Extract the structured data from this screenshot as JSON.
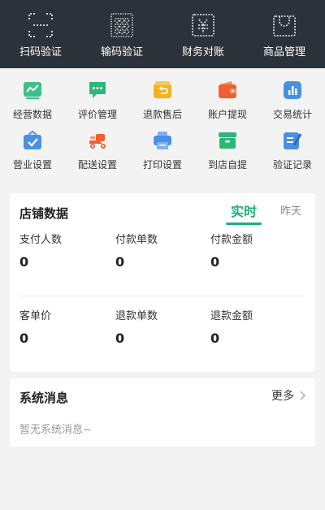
{
  "header": {
    "items": [
      {
        "label": "扫码验证",
        "icon": "scan-icon"
      },
      {
        "label": "输码验证",
        "icon": "code-input-icon"
      },
      {
        "label": "财务对账",
        "icon": "finance-icon"
      },
      {
        "label": "商品管理",
        "icon": "goods-icon"
      }
    ]
  },
  "grid": {
    "row1": [
      {
        "label": "经营数据",
        "icon": "business-data-icon",
        "color": "#3cc08a"
      },
      {
        "label": "评价管理",
        "icon": "review-icon",
        "color": "#2cb77a"
      },
      {
        "label": "退款售后",
        "icon": "refund-icon",
        "color": "#f5b21f"
      },
      {
        "label": "账户提现",
        "icon": "wallet-icon",
        "color": "#f0602f"
      },
      {
        "label": "交易统计",
        "icon": "stats-icon",
        "color": "#4a90e2"
      }
    ],
    "row2": [
      {
        "label": "营业设置",
        "icon": "business-settings-icon",
        "color": "#4a90e2"
      },
      {
        "label": "配送设置",
        "icon": "delivery-icon",
        "color": "#f0602f"
      },
      {
        "label": "打印设置",
        "icon": "printer-icon",
        "color": "#4a90e2"
      },
      {
        "label": "到店自提",
        "icon": "pickup-icon",
        "color": "#2cb77a"
      },
      {
        "label": "验证记录",
        "icon": "record-icon",
        "color": "#4a90e2"
      }
    ]
  },
  "store_data": {
    "title": "店铺数据",
    "tabs": {
      "realtime": "实时",
      "yesterday": "昨天"
    },
    "metrics": [
      {
        "label": "支付人数",
        "value": "0"
      },
      {
        "label": "付款单数",
        "value": "0"
      },
      {
        "label": "付款金额",
        "value": "0"
      },
      {
        "label": "客单价",
        "value": "0"
      },
      {
        "label": "退款单数",
        "value": "0"
      },
      {
        "label": "退款金额",
        "value": "0"
      }
    ]
  },
  "system_msg": {
    "title": "系统消息",
    "more": "更多",
    "empty": "暂无系统消息~"
  },
  "colors": {
    "header_bg": "#2c3239",
    "accent": "#1fae7a"
  }
}
